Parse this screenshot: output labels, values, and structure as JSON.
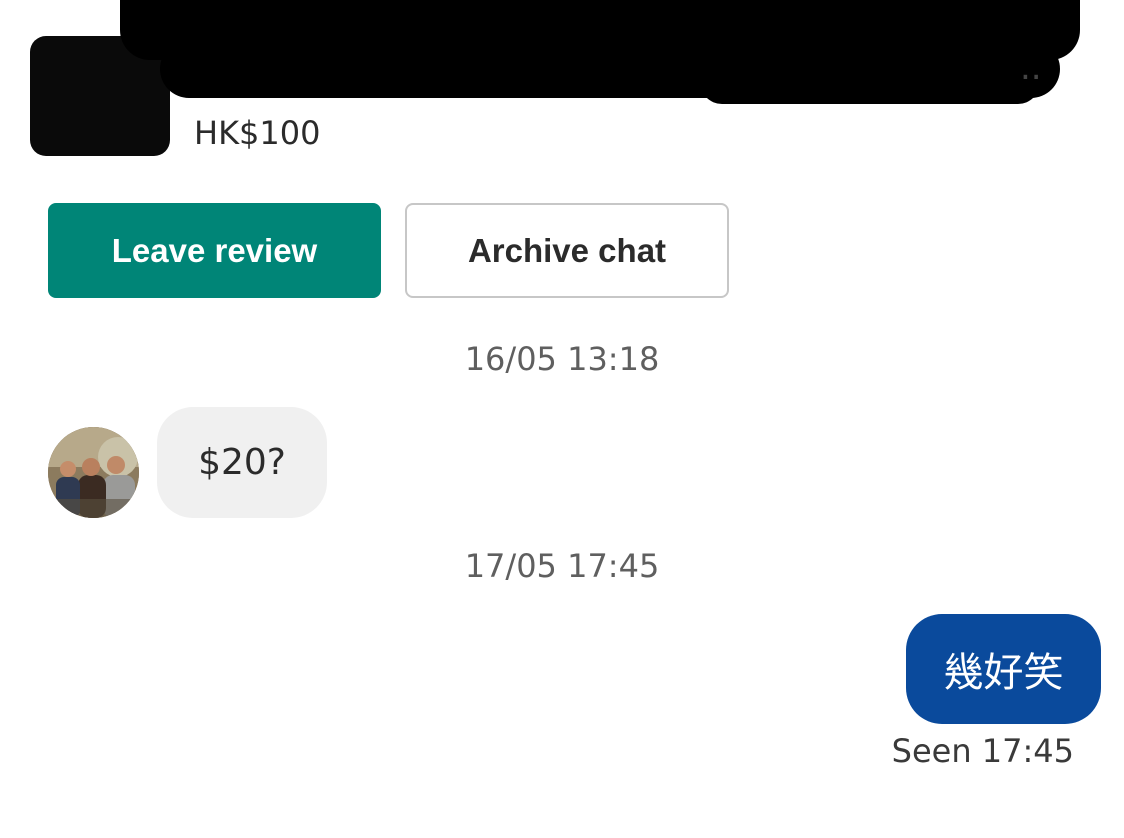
{
  "listing": {
    "title_visible_tail": "..",
    "price": "HK$100"
  },
  "actions": {
    "leave_review_label": "Leave review",
    "archive_chat_label": "Archive chat"
  },
  "colors": {
    "primary_button": "#008577",
    "outgoing_bubble": "#0a4a9c",
    "incoming_bubble": "#f0f0f0"
  },
  "conversation": {
    "messages": [
      {
        "timestamp": "16/05 13:18",
        "direction": "incoming",
        "text": "$20?"
      },
      {
        "timestamp": "17/05 17:45",
        "direction": "outgoing",
        "text": "幾好笑"
      }
    ],
    "read_receipt": "Seen 17:45"
  }
}
